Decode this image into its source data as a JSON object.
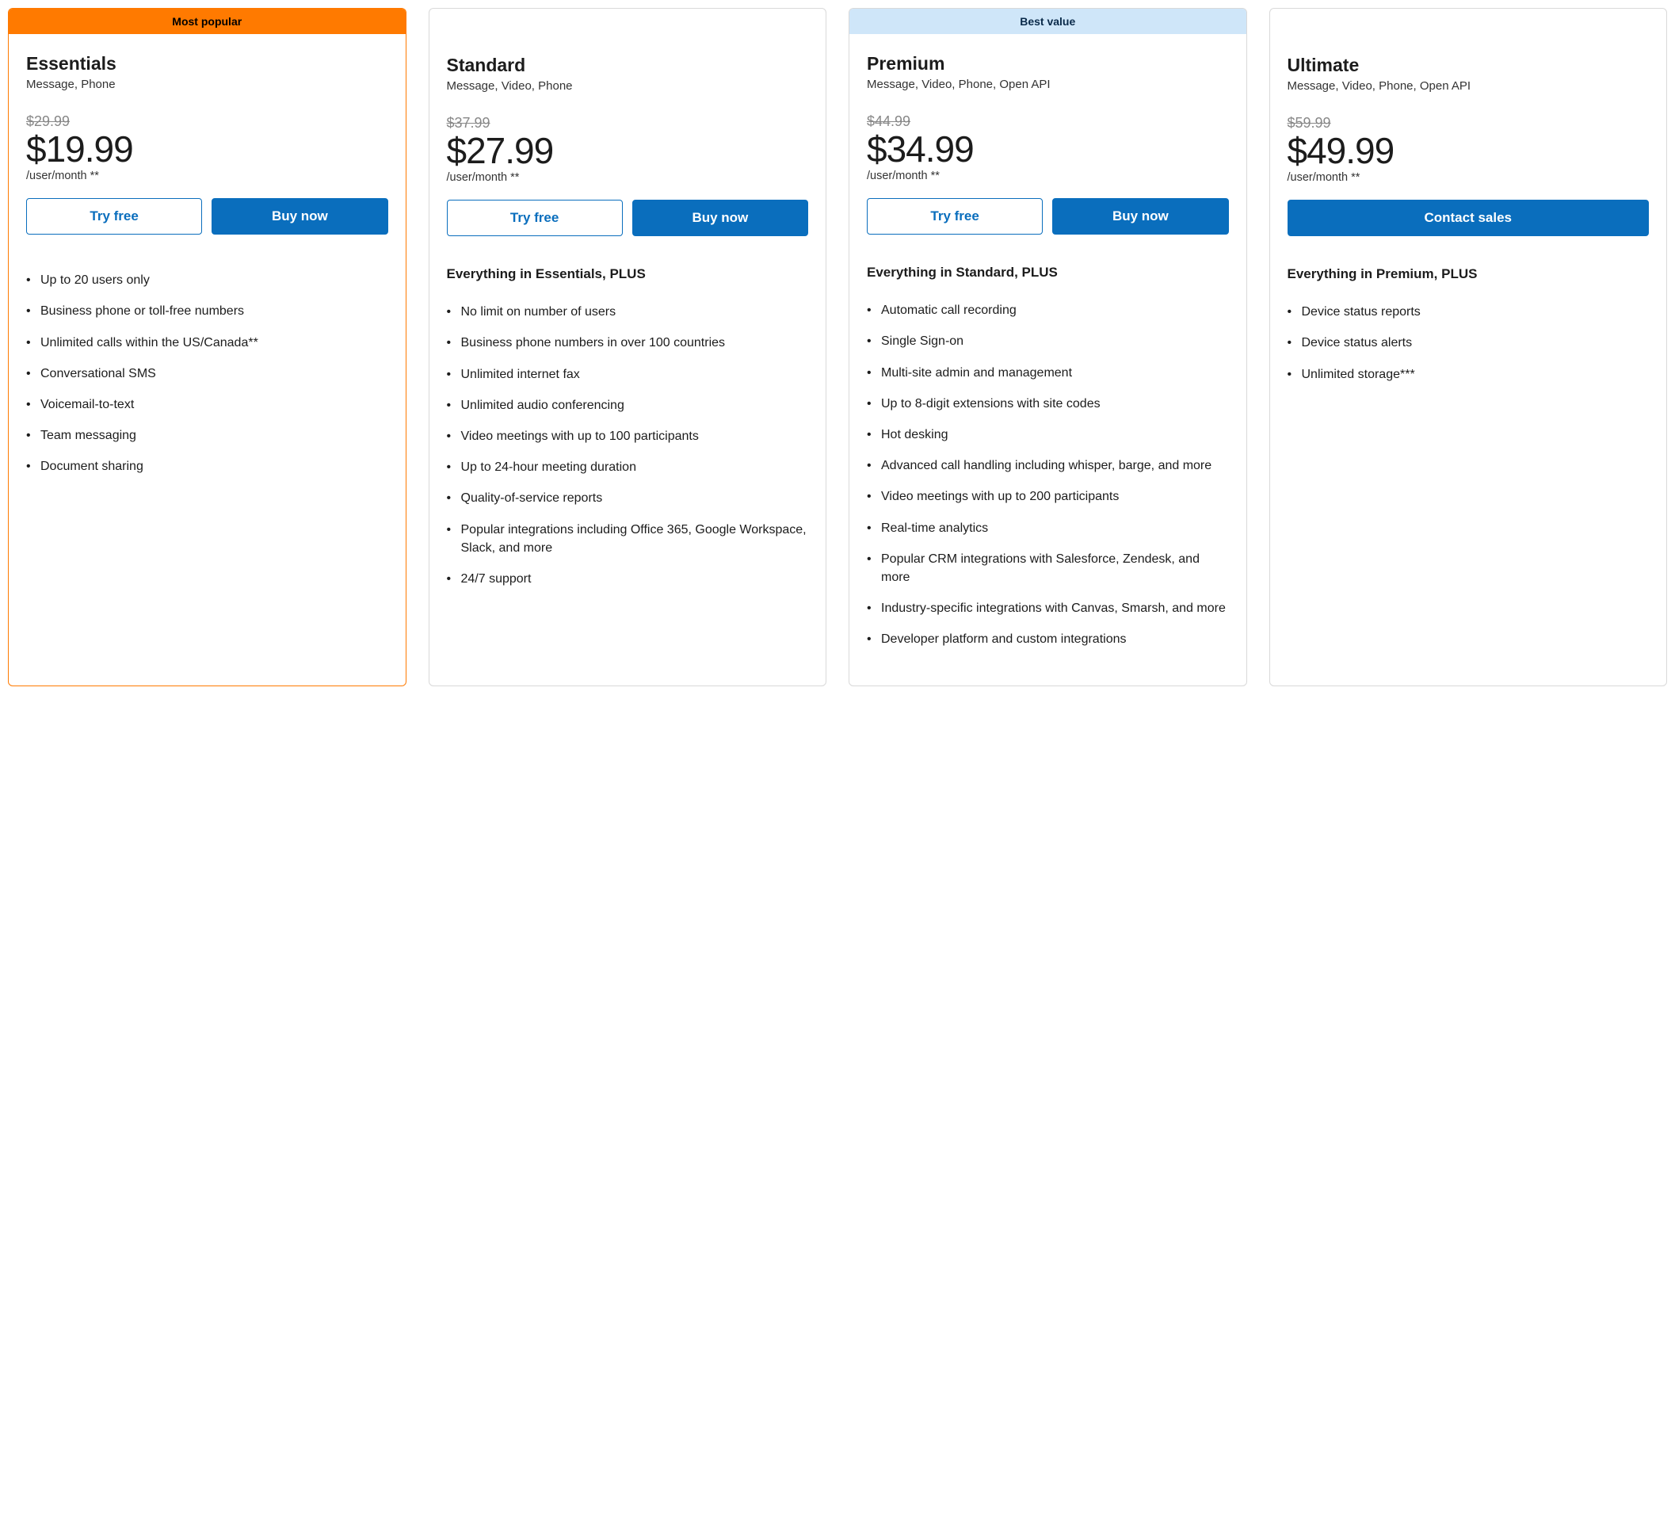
{
  "labels": {
    "try_free": "Try free",
    "buy_now": "Buy now",
    "contact_sales": "Contact sales",
    "most_popular": "Most popular",
    "best_value": "Best value",
    "per_unit": "/user/month **"
  },
  "plans": [
    {
      "badge": "popular",
      "name": "Essentials",
      "sub": "Message, Phone",
      "old_price": "$29.99",
      "price": "$19.99",
      "cta": "pair",
      "plus": "",
      "features": [
        "Up to 20 users only",
        "Business phone or toll-free numbers",
        "Unlimited calls within the US/Canada**",
        "Conversational SMS",
        "Voicemail-to-text",
        "Team messaging",
        "Document sharing"
      ]
    },
    {
      "badge": "",
      "name": "Standard",
      "sub": "Message, Video, Phone",
      "old_price": "$37.99",
      "price": "$27.99",
      "cta": "pair",
      "plus": "Everything in Essentials, PLUS",
      "features": [
        "No limit on number of users",
        "Business phone numbers in over 100 countries",
        "Unlimited internet fax",
        "Unlimited audio conferencing",
        "Video meetings with up to 100 participants",
        "Up to 24-hour meeting duration",
        "Quality-of-service reports",
        "Popular integrations including Office 365, Google Workspace, Slack, and more",
        "24/7 support"
      ]
    },
    {
      "badge": "value",
      "name": "Premium",
      "sub": "Message, Video, Phone, Open API",
      "old_price": "$44.99",
      "price": "$34.99",
      "cta": "pair",
      "plus": "Everything in Standard, PLUS",
      "features": [
        "Automatic call recording",
        "Single Sign-on",
        "Multi-site admin and management",
        "Up to 8-digit extensions with site codes",
        "Hot desking",
        "Advanced call handling including whisper, barge, and more",
        "Video meetings with up to 200 participants",
        "Real-time analytics",
        "Popular CRM integrations with Salesforce, Zendesk, and more",
        "Industry-specific integrations with Canvas, Smarsh, and more",
        "Developer platform and custom integrations"
      ]
    },
    {
      "badge": "",
      "name": "Ultimate",
      "sub": "Message, Video, Phone, Open API",
      "old_price": "$59.99",
      "price": "$49.99",
      "cta": "contact",
      "plus": "Everything in Premium, PLUS",
      "features": [
        "Device status reports",
        "Device status alerts",
        "Unlimited storage***"
      ]
    }
  ]
}
